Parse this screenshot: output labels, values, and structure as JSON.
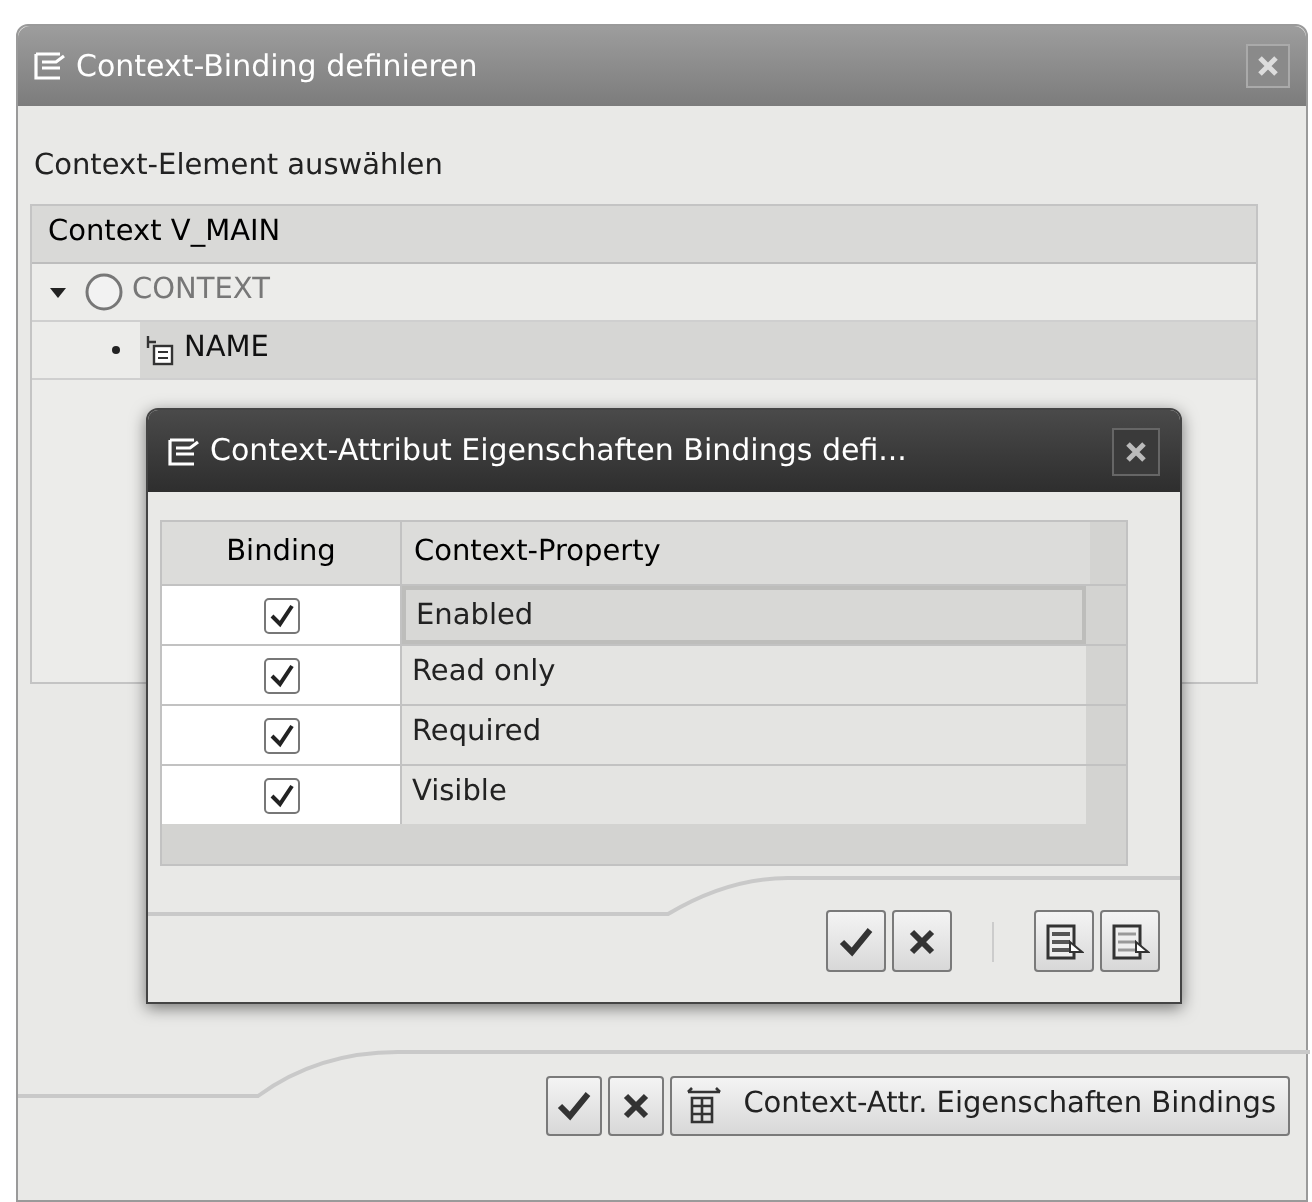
{
  "window": {
    "title": "Context-Binding definieren"
  },
  "section_label": "Context-Element auswählen",
  "tree": {
    "header": "Context V_MAIN",
    "nodes": [
      {
        "label": "CONTEXT",
        "kind": "node",
        "expanded": true,
        "selected": false,
        "children": [
          {
            "label": "NAME",
            "kind": "attribute",
            "selected": true
          }
        ]
      }
    ]
  },
  "dialog": {
    "title": "Context-Attribut Eigenschaften Bindings defi...",
    "columns": [
      "Binding",
      "Context-Property"
    ],
    "rows": [
      {
        "binding": true,
        "property": "Enabled",
        "selected": true
      },
      {
        "binding": true,
        "property": "Read only",
        "selected": false
      },
      {
        "binding": true,
        "property": "Required",
        "selected": false
      },
      {
        "binding": true,
        "property": "Visible",
        "selected": false
      }
    ]
  },
  "footer": {
    "action_button": "Context-Attr. Eigenschaften Bindings"
  }
}
